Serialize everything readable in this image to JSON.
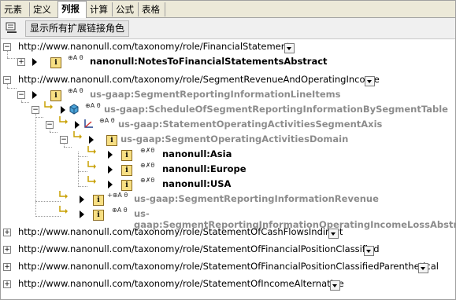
{
  "tabs": [
    "元素",
    "定义",
    "列报",
    "计算",
    "公式",
    "表格"
  ],
  "toolbar": {
    "show_roles_label": "显示所有扩展链接角色"
  },
  "tree": {
    "roles": [
      {
        "url": "http://www.nanonull.com/taxonomy/role/FinancialStatements"
      },
      {
        "url": "http://www.nanonull.com/taxonomy/role/SegmentRevenueAndOperatingIncome"
      },
      {
        "url": "http://www.nanonull.com/taxonomy/role/StatementOfCashFlowsIndirect"
      },
      {
        "url": "http://www.nanonull.com/taxonomy/role/StatementOfFinancialPositionClassified"
      },
      {
        "url": "http://www.nanonull.com/taxonomy/role/StatementOfFinancialPositionClassifiedParenthetical"
      },
      {
        "url": "http://www.nanonull.com/taxonomy/role/StatementOfIncomeAlternative"
      }
    ],
    "nodes": [
      {
        "label": "nanonull:NotesToFinancialStatementsAbstract",
        "icon": "i",
        "flags": "⊕A θ"
      },
      {
        "label": "us-gaap:SegmentReportingInformationLineItems",
        "icon": "i",
        "flags": "⊕A θ"
      },
      {
        "label": "us-gaap:ScheduleOfSegmentReportingInformationBySegmentTable",
        "icon": "cube",
        "flags": "⊕A θ"
      },
      {
        "label": "us-gaap:StatementOperatingActivitiesSegmentAxis",
        "icon": "axis",
        "flags": "⊕A θ"
      },
      {
        "label": "us-gaap:SegmentOperatingActivitiesDomain",
        "icon": "i",
        "flags": ""
      },
      {
        "label": "nanonull:Asia",
        "icon": "i",
        "flags": "⊕✗θ"
      },
      {
        "label": "nanonull:Europe",
        "icon": "i",
        "flags": "⊕✗θ"
      },
      {
        "label": "nanonull:USA",
        "icon": "i",
        "flags": "⊕✗θ"
      },
      {
        "label": "us-gaap:SegmentReportingInformationRevenue",
        "icon": "i",
        "flags": "+⊕A θ"
      },
      {
        "label": "us-gaap:SegmentReportingInformationOperatingIncomeLossAbstract",
        "icon": "i",
        "flags": "⊕A θ"
      }
    ]
  },
  "colors": {
    "tab_bg": "#ece9d8",
    "dimmed_text": "#8c8c8c",
    "item_icon_fill": "#f7df83"
  }
}
